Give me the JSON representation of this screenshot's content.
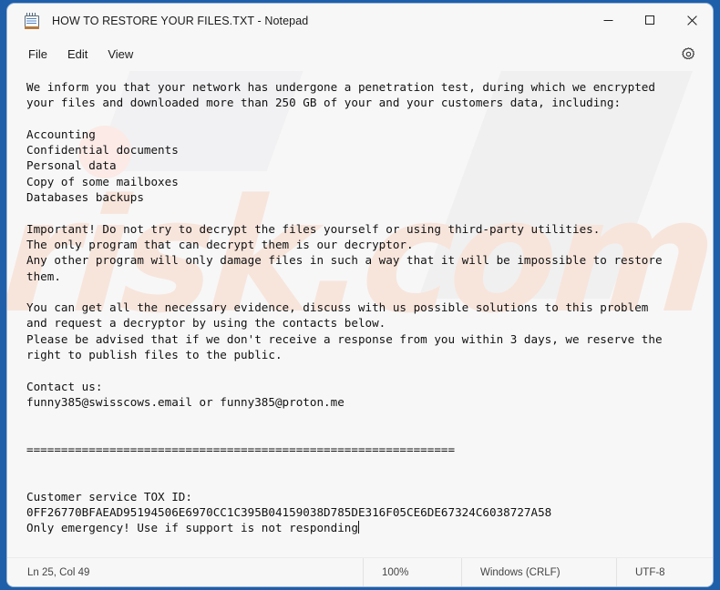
{
  "window": {
    "title": "HOW TO RESTORE YOUR FILES.TXT - Notepad",
    "icon": "notepad-icon",
    "controls": {
      "minimize": "minimize-icon",
      "maximize": "maximize-icon",
      "close": "close-icon"
    }
  },
  "menu": {
    "items": [
      {
        "label": "File"
      },
      {
        "label": "Edit"
      },
      {
        "label": "View"
      }
    ],
    "settings_icon": "gear-icon"
  },
  "editor": {
    "watermark": "risk.com",
    "text": "We inform you that your network has undergone a penetration test, during which we encrypted\nyour files and downloaded more than 250 GB of your and your customers data, including:\n\nAccounting\nConfidential documents\nPersonal data\nCopy of some mailboxes\nDatabases backups\n\nImportant! Do not try to decrypt the files yourself or using third-party utilities.\nThe only program that can decrypt them is our decryptor.\nAny other program will only damage files in such a way that it will be impossible to restore\nthem.\n\nYou can get all the necessary evidence, discuss with us possible solutions to this problem\nand request a decryptor by using the contacts below.\nPlease be advised that if we don't receive a response from you within 3 days, we reserve the\nright to publish files to the public.\n\nContact us:\nfunny385@swisscows.email or funny385@proton.me\n\n\n==============================================================\n\n\nCustomer service TOX ID:\n0FF26770BFAEAD95194506E6970CC1C395B04159038D785DE316F05CE6DE67324C6038727A58\nOnly emergency! Use if support is not responding"
  },
  "status_bar": {
    "position": "Ln 25, Col 49",
    "zoom": "100%",
    "line_ending": "Windows (CRLF)",
    "encoding": "UTF-8"
  },
  "colors": {
    "desktop": "#1f5fa9",
    "window_bg": "#f7f7f7",
    "text": "#111111",
    "watermark": "#f7e5dc"
  }
}
